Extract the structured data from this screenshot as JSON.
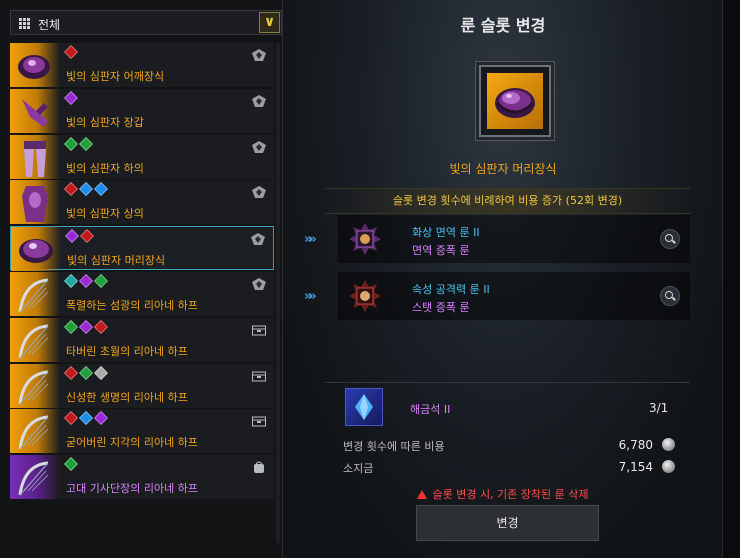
{
  "filter": {
    "label": "전체",
    "icon": "grid-icon",
    "dropdown_icon": "chevron-down-icon"
  },
  "items": [
    {
      "name": "빛의 심판자 어깨장식",
      "gems": [
        "r"
      ],
      "tier": "orange",
      "icon": "shoulder-icon",
      "eq_icon": "equipped-icon"
    },
    {
      "name": "빛의 심판자 장갑",
      "gems": [
        "p"
      ],
      "tier": "orange",
      "icon": "glove-icon",
      "eq_icon": "equipped-icon"
    },
    {
      "name": "빛의 심판자 하의",
      "gems": [
        "g",
        "g"
      ],
      "tier": "orange",
      "icon": "pants-icon",
      "eq_icon": "equipped-icon"
    },
    {
      "name": "빛의 심판자 상의",
      "gems": [
        "r",
        "b",
        "b"
      ],
      "tier": "orange",
      "icon": "chest-icon",
      "eq_icon": "equipped-icon"
    },
    {
      "name": "빛의 심판자 머리장식",
      "gems": [
        "p",
        "r"
      ],
      "tier": "orange",
      "icon": "helmet-icon",
      "eq_icon": "equipped-icon",
      "selected": true
    },
    {
      "name": "폭렬하는 섬광의 리아네 하프",
      "gems": [
        "c",
        "p",
        "g"
      ],
      "tier": "orange",
      "icon": "harp-icon",
      "eq_icon": "equipped-icon"
    },
    {
      "name": "타버린 초월의 리아네 하프",
      "gems": [
        "g",
        "p",
        "r"
      ],
      "tier": "orange",
      "icon": "harp-icon",
      "eq_icon": "storage-icon"
    },
    {
      "name": "신성한 생명의 리아네 하프",
      "gems": [
        "r",
        "g",
        "w"
      ],
      "tier": "orange",
      "icon": "harp-icon",
      "eq_icon": "storage-icon"
    },
    {
      "name": "굳어버린 지각의 리아네 하프",
      "gems": [
        "r",
        "b",
        "p"
      ],
      "tier": "orange",
      "icon": "harp-icon",
      "eq_icon": "storage-icon"
    },
    {
      "name": "고대 기사단장의 리아네 하프",
      "gems": [
        "g"
      ],
      "tier": "purple",
      "icon": "harp-icon",
      "eq_icon": "bag-icon"
    }
  ],
  "panel": {
    "title": "룬 슬롯 변경",
    "selected_item": "빛의 심판자 머리장식",
    "notice": "슬롯 변경 횟수에 비례하여 비용 증가 (52회 변경)"
  },
  "runes": [
    {
      "name": "화상 면역 룬 II",
      "sub": "면역 증폭 룬",
      "icon": "rune-icon",
      "search_icon": "search-icon",
      "arrow": "»»"
    },
    {
      "name": "속성 공격력 룬 II",
      "sub": "스탯 증폭 룬",
      "icon": "rune-icon",
      "search_icon": "search-icon",
      "arrow": "»»"
    }
  ],
  "material": {
    "name": "해금석 II",
    "count": "3/1",
    "icon": "crystal-icon"
  },
  "costs": {
    "change_cost_label": "변경 횟수에 따른 비용",
    "change_cost_value": "6,780",
    "owned_label": "소지금",
    "owned_value": "7,154",
    "coin_icon": "silver-coin-icon"
  },
  "warning": "슬롯 변경 시, 기존 장착된 룬 삭제",
  "button_label": "변경",
  "colors": {
    "accent_orange": "#f2a51c",
    "rune_blue": "#4bc3f0",
    "rune_purple": "#d884ff",
    "warning_red": "#ff4e4e",
    "selection_border": "#3aa3b8"
  }
}
